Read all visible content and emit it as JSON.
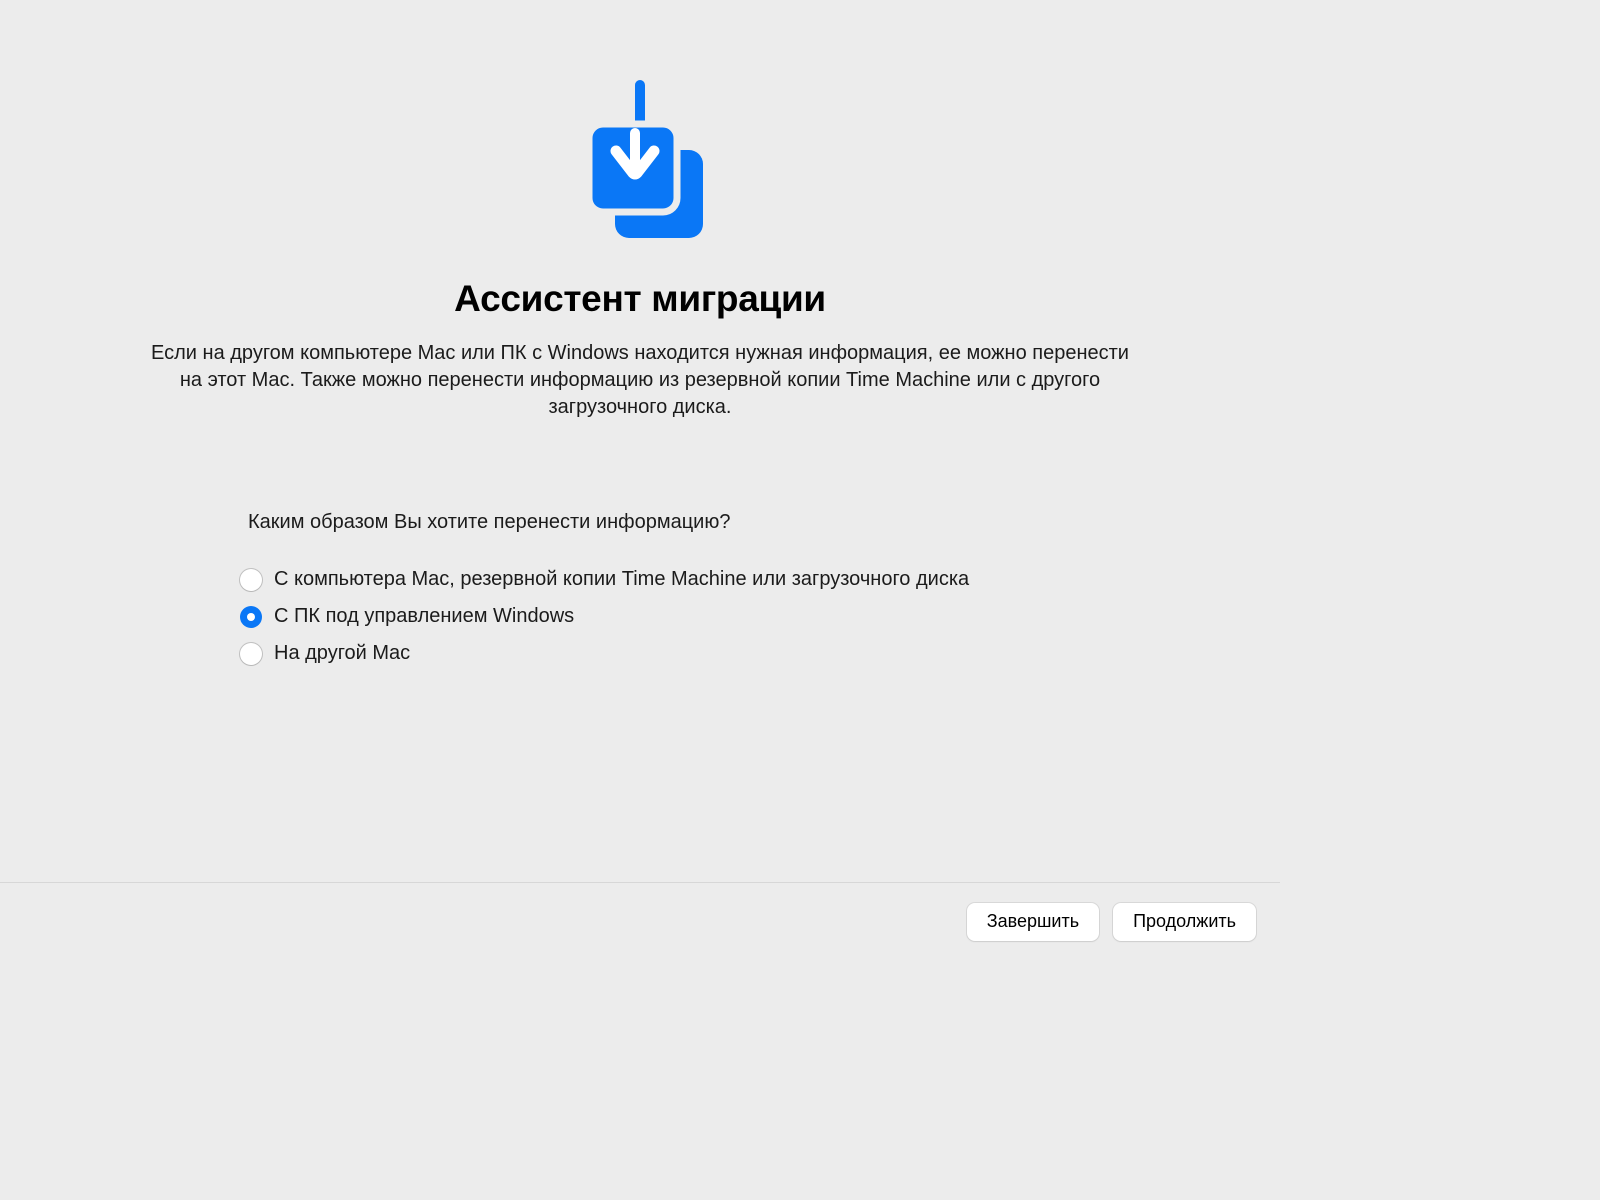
{
  "header": {
    "title": "Ассистент миграции",
    "description": "Если на другом компьютере Mac или ПК с Windows находится нужная информация, ее можно перенести на этот Mac. Также можно перенести информацию из резервной копии Time Machine или с другого загрузочного диска."
  },
  "form": {
    "question": "Каким образом Вы хотите перенести информацию?",
    "options": [
      {
        "label": "С компьютера Mac, резервной копии Time Machine или загрузочного диска",
        "selected": false
      },
      {
        "label": "С ПК под управлением Windows",
        "selected": true
      },
      {
        "label": "На другой Mac",
        "selected": false
      }
    ]
  },
  "footer": {
    "quit_label": "Завершить",
    "continue_label": "Продолжить"
  }
}
